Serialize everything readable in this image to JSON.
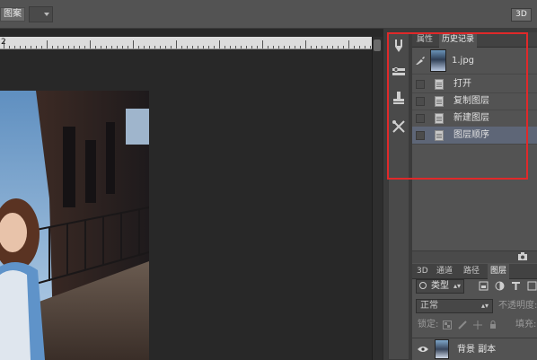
{
  "options_bar": {
    "pattern_label": "图案",
    "btn_3d": "3D"
  },
  "ruler": {
    "number": "2"
  },
  "history_panel": {
    "tabs": [
      {
        "label": "属性",
        "active": false
      },
      {
        "label": "历史记录",
        "active": true
      }
    ],
    "snapshot": {
      "label": "1.jpg"
    },
    "items": [
      {
        "label": "打开"
      },
      {
        "label": "复制图层"
      },
      {
        "label": "新建图层"
      },
      {
        "label": "图层顺序",
        "selected": true
      }
    ]
  },
  "layers_panel": {
    "tabs": [
      {
        "label": "3D"
      },
      {
        "label": "通道"
      },
      {
        "label": "路径"
      },
      {
        "label": "图层",
        "active": true
      }
    ],
    "kind_filter": "类型",
    "blend_mode": "正常",
    "opacity_label": "不透明度:",
    "lock_label": "锁定:",
    "fill_label": "填充:",
    "layer": {
      "name": "背景 副本"
    }
  },
  "colors": {
    "accent_box": "#e0292a",
    "selected_row": "#5e6677",
    "panel": "#535353"
  }
}
